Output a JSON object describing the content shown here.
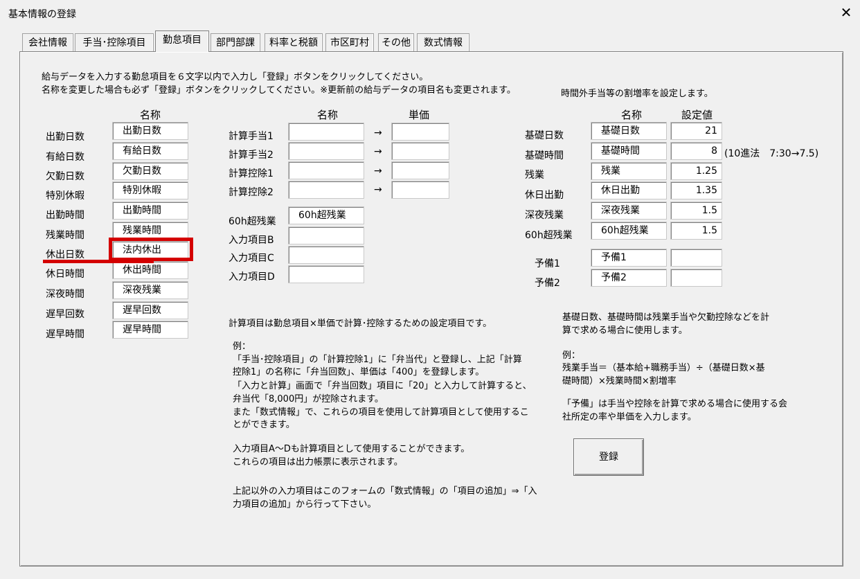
{
  "window": {
    "title": "基本情報の登録",
    "close_glyph": "✕"
  },
  "tabs": [
    "会社情報",
    "手当･控除項目",
    "勤怠項目",
    "部門部課",
    "料率と税額",
    "市区町村",
    "その他",
    "数式情報"
  ],
  "active_tab": "勤怠項目",
  "intro": {
    "line1": "給与データを入力する勤怠項目を６文字以内で入力し「登録」ボタンをクリックしてください。",
    "line2": "名称を変更した場合も必ず「登録」ボタンをクリックしてください。※更新前の給与データの項目名も変更されます。"
  },
  "left": {
    "header": "名称",
    "rows": [
      {
        "label": "出勤日数",
        "value": "出勤日数"
      },
      {
        "label": "有給日数",
        "value": "有給日数"
      },
      {
        "label": "欠勤日数",
        "value": "欠勤日数"
      },
      {
        "label": "特別休暇",
        "value": "特別休暇"
      },
      {
        "label": "出勤時間",
        "value": "出勤時間"
      },
      {
        "label": "残業時間",
        "value": "残業時間"
      },
      {
        "label": "休出日数",
        "value": "法内休出"
      },
      {
        "label": "休日時間",
        "value": "休出時間"
      },
      {
        "label": "深夜時間",
        "value": "深夜残業"
      },
      {
        "label": "遅早回数",
        "value": "遅早回数"
      },
      {
        "label": "遅早時間",
        "value": "遅早時間"
      }
    ]
  },
  "middle": {
    "header_name": "名称",
    "header_price": "単価",
    "arrow": "→",
    "calc_rows": [
      {
        "label": "計算手当1",
        "value": "",
        "price": ""
      },
      {
        "label": "計算手当2",
        "value": "",
        "price": ""
      },
      {
        "label": "計算控除1",
        "value": "",
        "price": ""
      },
      {
        "label": "計算控除2",
        "value": "",
        "price": ""
      }
    ],
    "input_rows": [
      {
        "label": "60h超残業",
        "value": "60h超残業"
      },
      {
        "label": "入力項目B",
        "value": ""
      },
      {
        "label": "入力項目C",
        "value": ""
      },
      {
        "label": "入力項目D",
        "value": ""
      }
    ],
    "note": "計算項目は勤怠項目×単価で計算･控除するための設定項目です。",
    "example": [
      "例：",
      "「手当･控除項目」の「計算控除1」に「弁当代」と登録し、上記「計算",
      "控除1」の名称に「弁当回数」、単価は「400」を登録します。",
      "「入力と計算」画面で「弁当回数」項目に「20」と入力して計算すると、",
      "弁当代「8,000円」が控除されます。",
      "また「数式情報」で、これらの項目を使用して計算項目として使用するこ",
      "とができます。"
    ],
    "note2": [
      "入力項目A～Dも計算項目として使用することができます。",
      "これらの項目は出力帳票に表示されます。"
    ],
    "note3": [
      "上記以外の入力項目はこのフォームの「数式情報」の「項目の追加」⇒「入",
      "力項目の追加」から行って下さい。"
    ]
  },
  "right": {
    "caption": "時間外手当等の割増率を設定します。",
    "header_name": "名称",
    "header_value": "設定値",
    "rows": [
      {
        "label": "基礎日数",
        "name": "基礎日数",
        "value": "21"
      },
      {
        "label": "基礎時間",
        "name": "基礎時間",
        "value": "8"
      },
      {
        "label": "残業",
        "name": "残業",
        "value": "1.25"
      },
      {
        "label": "休日出勤",
        "name": "休日出勤",
        "value": "1.35"
      },
      {
        "label": "深夜残業",
        "name": "深夜残業",
        "value": "1.5"
      },
      {
        "label": "60h超残業",
        "name": "60h超残業",
        "value": "1.5"
      }
    ],
    "hint_after_hours": "(10進法　7:30→7.5)",
    "spare_rows": [
      {
        "label": "予備1",
        "name": "予備1",
        "value": ""
      },
      {
        "label": "予備2",
        "name": "予備2",
        "value": ""
      }
    ],
    "note1": [
      "基礎日数、基礎時間は残業手当や欠勤控除などを計",
      "算で求める場合に使用します。"
    ],
    "example": [
      "例：",
      "残業手当＝（基本給+職務手当）÷（基礎日数×基",
      "礎時間）×残業時間×割増率"
    ],
    "note2": [
      "「予備」は手当や控除を計算で求める場合に使用する会",
      "社所定の率や単価を入力します。"
    ],
    "register_button": "登録"
  },
  "highlight_color": "#d40000"
}
